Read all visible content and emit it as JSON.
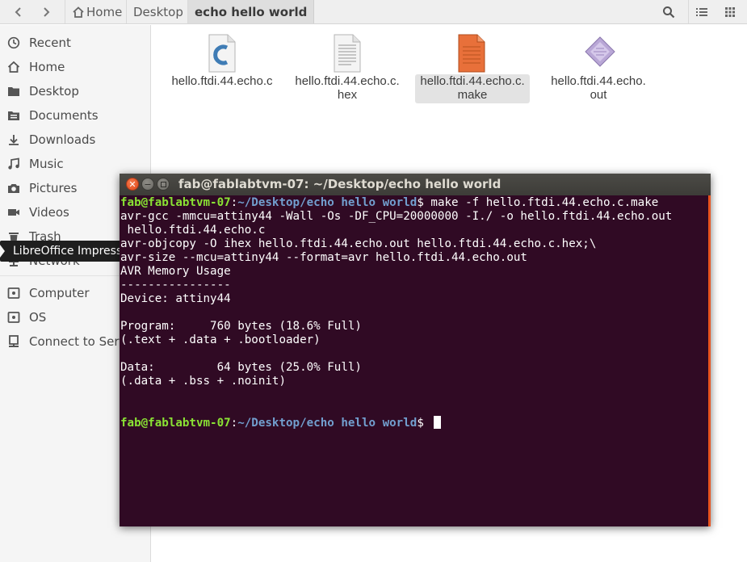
{
  "header": {
    "breadcrumbs": [
      "Home",
      "Desktop",
      "echo hello world"
    ]
  },
  "sidebar": {
    "items": [
      {
        "label": "Recent",
        "icon": "clock-icon"
      },
      {
        "label": "Home",
        "icon": "home-icon"
      },
      {
        "label": "Desktop",
        "icon": "folder-icon"
      },
      {
        "label": "Documents",
        "icon": "documents-icon"
      },
      {
        "label": "Downloads",
        "icon": "download-icon"
      },
      {
        "label": "Music",
        "icon": "music-icon"
      },
      {
        "label": "Pictures",
        "icon": "camera-icon"
      },
      {
        "label": "Videos",
        "icon": "video-icon"
      },
      {
        "label": "Trash",
        "icon": "trash-icon"
      },
      {
        "label": "Network",
        "icon": "network-icon"
      },
      {
        "label": "Computer",
        "icon": "computer-icon"
      },
      {
        "label": "OS",
        "icon": "drive-icon"
      },
      {
        "label": "Connect to Server",
        "icon": "server-icon"
      }
    ]
  },
  "files": [
    {
      "line1": "hello.ftdi.44.echo.c",
      "line2": "",
      "icon": "c-source-icon"
    },
    {
      "line1": "hello.ftdi.44.echo.c.",
      "line2": "hex",
      "icon": "text-file-icon"
    },
    {
      "line1": "hello.ftdi.44.echo.c.",
      "line2": "make",
      "icon": "makefile-icon"
    },
    {
      "line1": "hello.ftdi.44.echo.",
      "line2": "out",
      "icon": "binary-file-icon"
    }
  ],
  "tooltip": "LibreOffice Impress",
  "terminal": {
    "title": "fab@fablabtvm-07: ~/Desktop/echo hello world",
    "prompt_user": "fab@fablabtvm-07",
    "prompt_sep": ":",
    "prompt_path": "~/Desktop/echo hello world",
    "prompt_end": "$ ",
    "command": "make -f hello.ftdi.44.echo.c.make",
    "output": [
      "avr-gcc -mmcu=attiny44 -Wall -Os -DF_CPU=20000000 -I./ -o hello.ftdi.44.echo.out",
      " hello.ftdi.44.echo.c",
      "avr-objcopy -O ihex hello.ftdi.44.echo.out hello.ftdi.44.echo.c.hex;\\",
      "avr-size --mcu=attiny44 --format=avr hello.ftdi.44.echo.out",
      "AVR Memory Usage",
      "----------------",
      "Device: attiny44",
      "",
      "Program:     760 bytes (18.6% Full)",
      "(.text + .data + .bootloader)",
      "",
      "Data:         64 bytes (25.0% Full)",
      "(.data + .bss + .noinit)"
    ]
  },
  "colors": {
    "terminal_bg": "#300a24",
    "prompt_user": "#8ae234",
    "prompt_path": "#729fcf",
    "close_button": "#e9541f"
  }
}
